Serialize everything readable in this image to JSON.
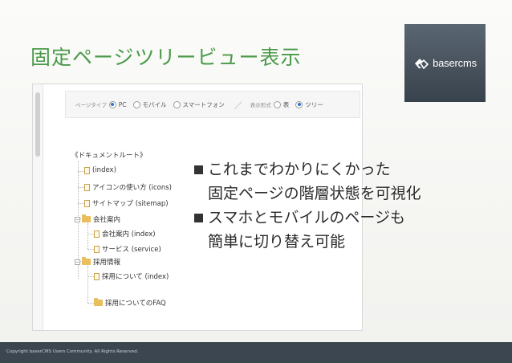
{
  "slide": {
    "title": "固定ページツリービュー表示",
    "logo_text": "basercms",
    "bullets": [
      {
        "lines": [
          "これまでわかりにくかった",
          "固定ページの階層状態を可視化"
        ]
      },
      {
        "lines": [
          "スマホとモバイルのページも",
          "簡単に切り替え可能"
        ]
      }
    ],
    "copyright": "Copyright baserCMS Users Community. All Rights Reserved."
  },
  "toolbar": {
    "page_type_label": "ページタイプ",
    "page_type_options": [
      {
        "label": "PC",
        "selected": true
      },
      {
        "label": "モバイル",
        "selected": false
      },
      {
        "label": "スマートフォン",
        "selected": false
      }
    ],
    "separator": "／",
    "view_label": "表示形式",
    "view_options": [
      {
        "label": "表",
        "selected": false
      },
      {
        "label": "ツリー",
        "selected": true
      }
    ]
  },
  "tree": {
    "root": "《ドキュメントルート》",
    "items": [
      {
        "label": "(index)",
        "type": "file"
      },
      {
        "label": "アイコンの使い方 (icons)",
        "type": "file"
      },
      {
        "label": "サイトマップ (sitemap)",
        "type": "file"
      },
      {
        "label": "会社案内",
        "type": "folder"
      },
      {
        "label": "会社案内 (index)",
        "type": "file"
      },
      {
        "label": "サービス (service)",
        "type": "file"
      },
      {
        "label": "採用情報",
        "type": "folder"
      },
      {
        "label": "採用について (index)",
        "type": "file"
      },
      {
        "label": "採用についてのFAQ",
        "type": "folder"
      }
    ]
  },
  "colors": {
    "title": "#4a9a4a",
    "logo_bg": "#46505a",
    "footer_bg": "#3c4650",
    "radio_selected": "#2f6fcf"
  },
  "icons": {
    "file": "document-icon",
    "folder": "folder-icon",
    "logo": "basercms-logo-icon"
  }
}
